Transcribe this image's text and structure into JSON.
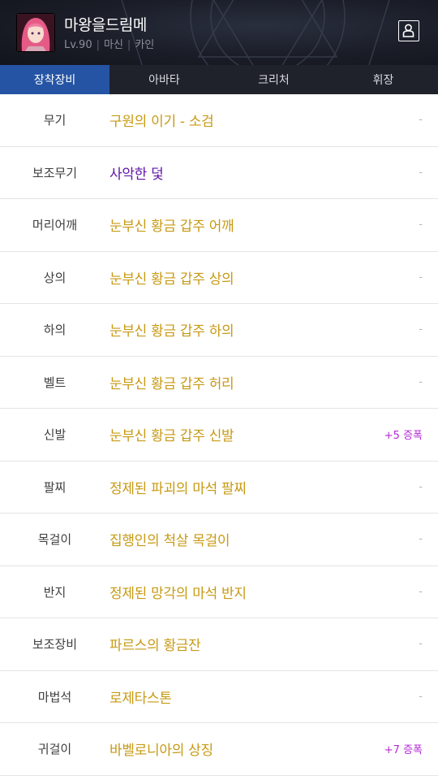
{
  "character": {
    "name": "마왕을드림메",
    "level": "Lv.90",
    "job": "마신",
    "server": "카인"
  },
  "tabs": [
    {
      "label": "장착장비",
      "active": true
    },
    {
      "label": "아바타",
      "active": false
    },
    {
      "label": "크리처",
      "active": false
    },
    {
      "label": "휘장",
      "active": false
    }
  ],
  "equipment": [
    {
      "slot": "무기",
      "item": "구원의 이기 - 소검",
      "rarity": "gold",
      "enhance": "-"
    },
    {
      "slot": "보조무기",
      "item": "사악한 덫",
      "rarity": "purple",
      "enhance": "-"
    },
    {
      "slot": "머리어깨",
      "item": "눈부신 황금 갑주 어깨",
      "rarity": "gold",
      "enhance": "-"
    },
    {
      "slot": "상의",
      "item": "눈부신 황금 갑주 상의",
      "rarity": "gold",
      "enhance": "-"
    },
    {
      "slot": "하의",
      "item": "눈부신 황금 갑주 하의",
      "rarity": "gold",
      "enhance": "-"
    },
    {
      "slot": "벨트",
      "item": "눈부신 황금 갑주 허리",
      "rarity": "gold",
      "enhance": "-"
    },
    {
      "slot": "신발",
      "item": "눈부신 황금 갑주 신발",
      "rarity": "gold",
      "enhance": "+5 증폭"
    },
    {
      "slot": "팔찌",
      "item": "정제된 파괴의 마석 팔찌",
      "rarity": "gold",
      "enhance": "-"
    },
    {
      "slot": "목걸이",
      "item": "집행인의 척살 목걸이",
      "rarity": "gold",
      "enhance": "-"
    },
    {
      "slot": "반지",
      "item": "정제된 망각의 마석 반지",
      "rarity": "gold",
      "enhance": "-"
    },
    {
      "slot": "보조장비",
      "item": "파르스의 황금잔",
      "rarity": "gold",
      "enhance": "-"
    },
    {
      "slot": "마법석",
      "item": "로제타스톤",
      "rarity": "gold",
      "enhance": "-"
    },
    {
      "slot": "귀걸이",
      "item": "바벨로니아의 상징",
      "rarity": "gold",
      "enhance": "+7 증폭"
    }
  ],
  "colors": {
    "gold": "#c79a14",
    "purple": "#6016a6",
    "amplify": "#b428d2",
    "tab_active": "#2554a5"
  },
  "icons": {
    "profile": "person-card-icon",
    "avatar": "character-portrait"
  }
}
